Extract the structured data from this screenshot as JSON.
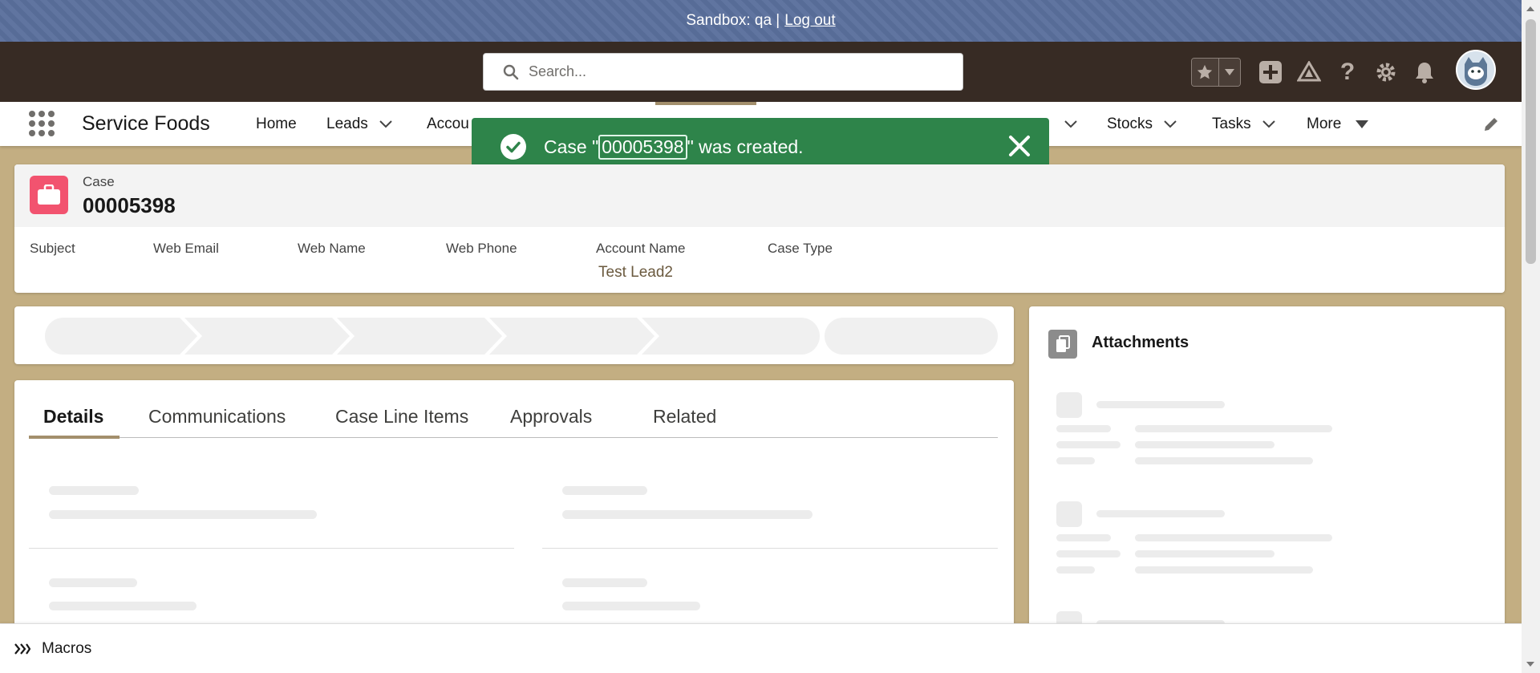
{
  "sandbox_bar": {
    "label": "Sandbox: qa |",
    "logout": "Log out"
  },
  "header": {
    "search_placeholder": "Search...",
    "icons": [
      "favorites-star-icon",
      "favorites-dropdown-icon",
      "global-actions-plus-icon",
      "trailhead-icon",
      "help-icon",
      "setup-gear-icon",
      "notifications-bell-icon",
      "user-avatar"
    ]
  },
  "nav": {
    "app_name": "Service Foods",
    "items": [
      {
        "label": "Home",
        "has_menu": false
      },
      {
        "label": "Leads",
        "has_menu": true
      },
      {
        "label": "Accou",
        "has_menu": false
      },
      {
        "label": "Stocks",
        "has_menu": true
      },
      {
        "label": "Tasks",
        "has_menu": true
      },
      {
        "label": "More",
        "has_menu": true
      }
    ]
  },
  "toast": {
    "prefix": "Case \"",
    "record": "00005398",
    "suffix": "\" was created.",
    "variant": "success",
    "color": "#2e844a"
  },
  "record": {
    "object_label": "Case",
    "title": "00005398",
    "icon_color": "#f2536f",
    "fields": [
      {
        "label": "Subject",
        "value": ""
      },
      {
        "label": "Web Email",
        "value": ""
      },
      {
        "label": "Web Name",
        "value": ""
      },
      {
        "label": "Web Phone",
        "value": ""
      },
      {
        "label": "Account Name",
        "value": "Test Lead2"
      },
      {
        "label": "Case Type",
        "value": ""
      }
    ]
  },
  "tabs": [
    "Details",
    "Communications",
    "Case Line Items",
    "Approvals",
    "Related"
  ],
  "active_tab": "Details",
  "attachments": {
    "title": "Attachments"
  },
  "utility_bar": {
    "macros": "Macros"
  },
  "theme": {
    "accent": "#a38f6c",
    "background": "#c3ae82",
    "header": "#372b24",
    "sandbox": "#5a6f9c"
  }
}
